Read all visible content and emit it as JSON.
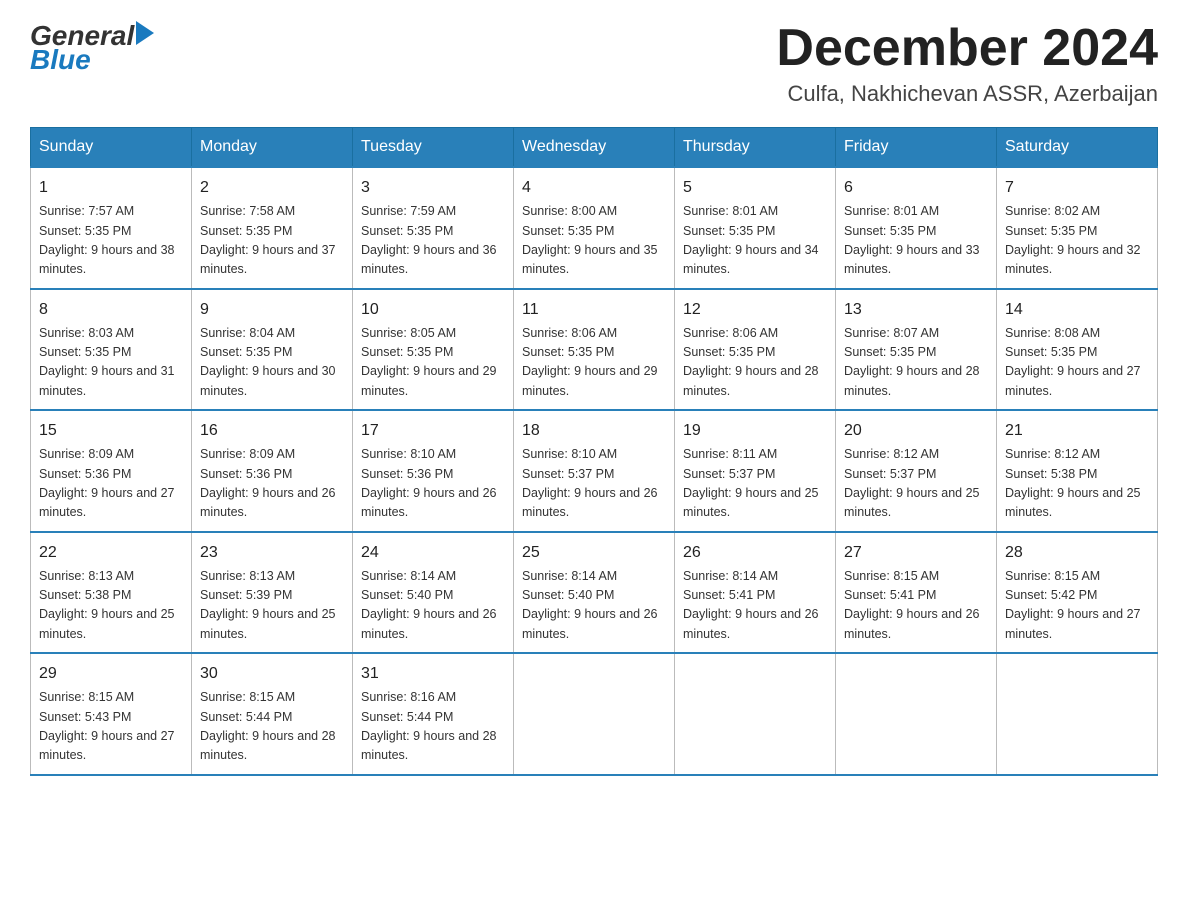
{
  "header": {
    "logo": {
      "text_general": "General",
      "text_blue": "Blue"
    },
    "title": "December 2024",
    "location": "Culfa, Nakhichevan ASSR, Azerbaijan"
  },
  "days_of_week": [
    "Sunday",
    "Monday",
    "Tuesday",
    "Wednesday",
    "Thursday",
    "Friday",
    "Saturday"
  ],
  "weeks": [
    [
      {
        "day": "1",
        "sunrise": "7:57 AM",
        "sunset": "5:35 PM",
        "daylight": "9 hours and 38 minutes."
      },
      {
        "day": "2",
        "sunrise": "7:58 AM",
        "sunset": "5:35 PM",
        "daylight": "9 hours and 37 minutes."
      },
      {
        "day": "3",
        "sunrise": "7:59 AM",
        "sunset": "5:35 PM",
        "daylight": "9 hours and 36 minutes."
      },
      {
        "day": "4",
        "sunrise": "8:00 AM",
        "sunset": "5:35 PM",
        "daylight": "9 hours and 35 minutes."
      },
      {
        "day": "5",
        "sunrise": "8:01 AM",
        "sunset": "5:35 PM",
        "daylight": "9 hours and 34 minutes."
      },
      {
        "day": "6",
        "sunrise": "8:01 AM",
        "sunset": "5:35 PM",
        "daylight": "9 hours and 33 minutes."
      },
      {
        "day": "7",
        "sunrise": "8:02 AM",
        "sunset": "5:35 PM",
        "daylight": "9 hours and 32 minutes."
      }
    ],
    [
      {
        "day": "8",
        "sunrise": "8:03 AM",
        "sunset": "5:35 PM",
        "daylight": "9 hours and 31 minutes."
      },
      {
        "day": "9",
        "sunrise": "8:04 AM",
        "sunset": "5:35 PM",
        "daylight": "9 hours and 30 minutes."
      },
      {
        "day": "10",
        "sunrise": "8:05 AM",
        "sunset": "5:35 PM",
        "daylight": "9 hours and 29 minutes."
      },
      {
        "day": "11",
        "sunrise": "8:06 AM",
        "sunset": "5:35 PM",
        "daylight": "9 hours and 29 minutes."
      },
      {
        "day": "12",
        "sunrise": "8:06 AM",
        "sunset": "5:35 PM",
        "daylight": "9 hours and 28 minutes."
      },
      {
        "day": "13",
        "sunrise": "8:07 AM",
        "sunset": "5:35 PM",
        "daylight": "9 hours and 28 minutes."
      },
      {
        "day": "14",
        "sunrise": "8:08 AM",
        "sunset": "5:35 PM",
        "daylight": "9 hours and 27 minutes."
      }
    ],
    [
      {
        "day": "15",
        "sunrise": "8:09 AM",
        "sunset": "5:36 PM",
        "daylight": "9 hours and 27 minutes."
      },
      {
        "day": "16",
        "sunrise": "8:09 AM",
        "sunset": "5:36 PM",
        "daylight": "9 hours and 26 minutes."
      },
      {
        "day": "17",
        "sunrise": "8:10 AM",
        "sunset": "5:36 PM",
        "daylight": "9 hours and 26 minutes."
      },
      {
        "day": "18",
        "sunrise": "8:10 AM",
        "sunset": "5:37 PM",
        "daylight": "9 hours and 26 minutes."
      },
      {
        "day": "19",
        "sunrise": "8:11 AM",
        "sunset": "5:37 PM",
        "daylight": "9 hours and 25 minutes."
      },
      {
        "day": "20",
        "sunrise": "8:12 AM",
        "sunset": "5:37 PM",
        "daylight": "9 hours and 25 minutes."
      },
      {
        "day": "21",
        "sunrise": "8:12 AM",
        "sunset": "5:38 PM",
        "daylight": "9 hours and 25 minutes."
      }
    ],
    [
      {
        "day": "22",
        "sunrise": "8:13 AM",
        "sunset": "5:38 PM",
        "daylight": "9 hours and 25 minutes."
      },
      {
        "day": "23",
        "sunrise": "8:13 AM",
        "sunset": "5:39 PM",
        "daylight": "9 hours and 25 minutes."
      },
      {
        "day": "24",
        "sunrise": "8:14 AM",
        "sunset": "5:40 PM",
        "daylight": "9 hours and 26 minutes."
      },
      {
        "day": "25",
        "sunrise": "8:14 AM",
        "sunset": "5:40 PM",
        "daylight": "9 hours and 26 minutes."
      },
      {
        "day": "26",
        "sunrise": "8:14 AM",
        "sunset": "5:41 PM",
        "daylight": "9 hours and 26 minutes."
      },
      {
        "day": "27",
        "sunrise": "8:15 AM",
        "sunset": "5:41 PM",
        "daylight": "9 hours and 26 minutes."
      },
      {
        "day": "28",
        "sunrise": "8:15 AM",
        "sunset": "5:42 PM",
        "daylight": "9 hours and 27 minutes."
      }
    ],
    [
      {
        "day": "29",
        "sunrise": "8:15 AM",
        "sunset": "5:43 PM",
        "daylight": "9 hours and 27 minutes."
      },
      {
        "day": "30",
        "sunrise": "8:15 AM",
        "sunset": "5:44 PM",
        "daylight": "9 hours and 28 minutes."
      },
      {
        "day": "31",
        "sunrise": "8:16 AM",
        "sunset": "5:44 PM",
        "daylight": "9 hours and 28 minutes."
      },
      null,
      null,
      null,
      null
    ]
  ]
}
